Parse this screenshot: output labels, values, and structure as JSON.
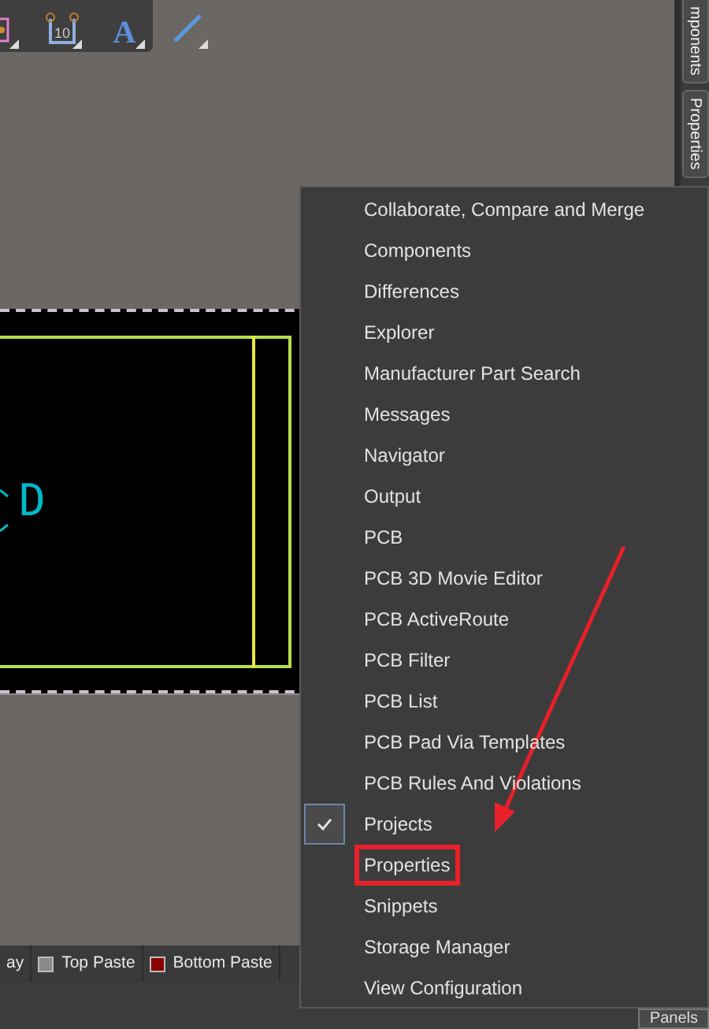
{
  "toolbar": [
    {
      "kind": "component"
    },
    {
      "kind": "dimension",
      "label": "10"
    },
    {
      "kind": "text",
      "label": "A"
    },
    {
      "kind": "line"
    }
  ],
  "side_tabs": [
    {
      "label": "mponents"
    },
    {
      "label": "Properties"
    }
  ],
  "board": {
    "silkscreen_text": "D"
  },
  "layer_tabs": [
    {
      "label": "ay"
    },
    {
      "label": "Top Paste",
      "color": "#8a8a8a"
    },
    {
      "label": "Bottom Paste",
      "color": "#8b0000"
    }
  ],
  "panels_button": "Panels",
  "menu": [
    {
      "label": "Collaborate, Compare and Merge",
      "checked": false,
      "highlighted": false
    },
    {
      "label": "Components",
      "checked": false,
      "highlighted": false
    },
    {
      "label": "Differences",
      "checked": false,
      "highlighted": false
    },
    {
      "label": "Explorer",
      "checked": false,
      "highlighted": false
    },
    {
      "label": "Manufacturer Part Search",
      "checked": false,
      "highlighted": false
    },
    {
      "label": "Messages",
      "checked": false,
      "highlighted": false
    },
    {
      "label": "Navigator",
      "checked": false,
      "highlighted": false
    },
    {
      "label": "Output",
      "checked": false,
      "highlighted": false
    },
    {
      "label": "PCB",
      "checked": false,
      "highlighted": false
    },
    {
      "label": "PCB 3D Movie Editor",
      "checked": false,
      "highlighted": false
    },
    {
      "label": "PCB ActiveRoute",
      "checked": false,
      "highlighted": false
    },
    {
      "label": "PCB Filter",
      "checked": false,
      "highlighted": false
    },
    {
      "label": "PCB List",
      "checked": false,
      "highlighted": false
    },
    {
      "label": "PCB Pad Via Templates",
      "checked": false,
      "highlighted": false
    },
    {
      "label": "PCB Rules And Violations",
      "checked": false,
      "highlighted": false
    },
    {
      "label": "Projects",
      "checked": true,
      "highlighted": false
    },
    {
      "label": "Properties",
      "checked": false,
      "highlighted": true
    },
    {
      "label": "Snippets",
      "checked": false,
      "highlighted": false
    },
    {
      "label": "Storage Manager",
      "checked": false,
      "highlighted": false
    },
    {
      "label": "View Configuration",
      "checked": false,
      "highlighted": false
    }
  ]
}
